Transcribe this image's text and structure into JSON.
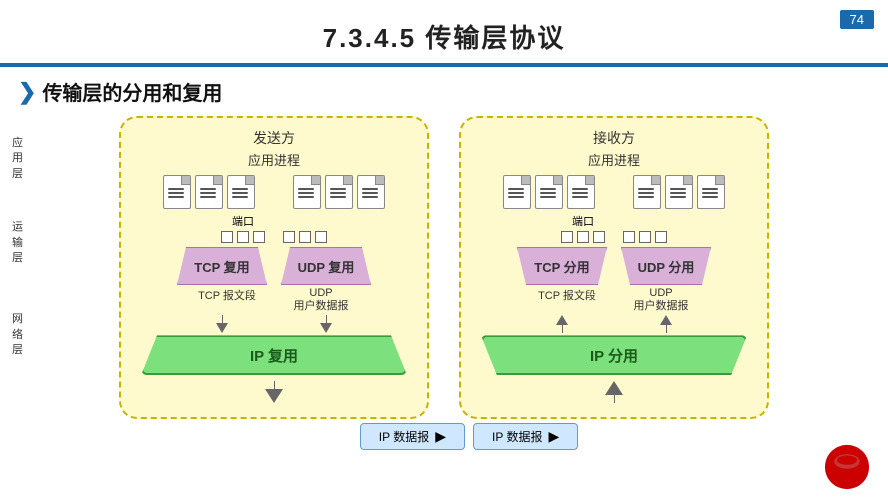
{
  "header": {
    "title": "7.3.4.5   传输层协议",
    "slide_number": "74"
  },
  "section": {
    "title": "传输层的分用和复用"
  },
  "left_labels": {
    "app_layer": [
      "应",
      "用",
      "层"
    ],
    "transport_layer": [
      "运",
      "输",
      "层"
    ],
    "network_layer": [
      "网",
      "络",
      "层"
    ]
  },
  "sender": {
    "title": "发送方",
    "app_process": "应用进程",
    "port_label": "端口",
    "tcp_label": "TCP 复用",
    "udp_label": "UDP 复用",
    "tcp_segment": "TCP 报文段",
    "udp_datagram": "UDP\n用户数据报",
    "ip_label": "IP 复用"
  },
  "receiver": {
    "title": "接收方",
    "app_process": "应用进程",
    "port_label": "端口",
    "tcp_label": "TCP 分用",
    "udp_label": "UDP 分用",
    "tcp_segment": "TCP 报文段",
    "udp_datagram": "UDP\n用户数据报",
    "ip_label": "IP 分用"
  },
  "bottom": {
    "sender_ip": "IP 数据报",
    "receiver_ip": "IP 数据报"
  },
  "colors": {
    "accent_blue": "#1a6aab",
    "yellow_bg": "#fffacd",
    "purple_funnel": "#d8b0d8",
    "green_ip": "#7ce07c",
    "light_blue_box": "#d0e8ff"
  }
}
